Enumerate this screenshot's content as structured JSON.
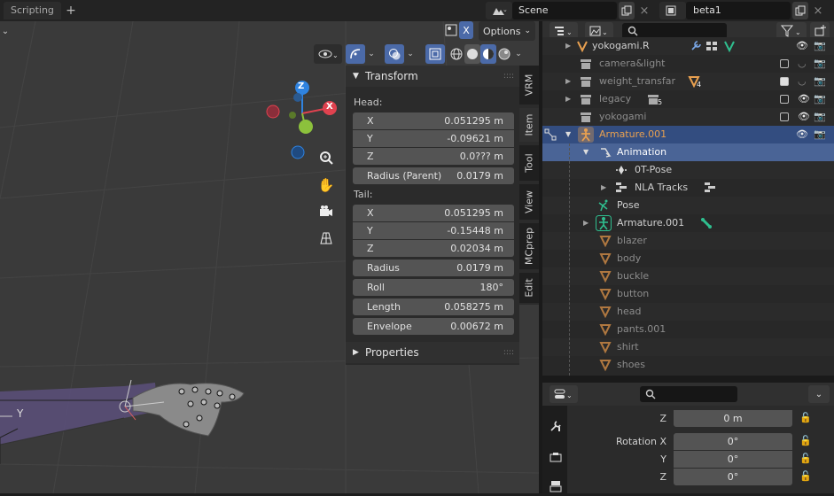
{
  "topbar": {
    "workspace_tab": "Scripting",
    "add_tab": "+",
    "scene_name": "Scene",
    "view_layer_name": "beta1"
  },
  "viewport": {
    "options_label": "Options",
    "x_mirror_label": "X",
    "gizmo": {
      "z": "Z",
      "x": "X",
      "y": "Y"
    },
    "bone_axis_label": "Y"
  },
  "sidebar_tabs": [
    "VRM",
    "Item",
    "Tool",
    "View",
    "MCprep",
    "Edit"
  ],
  "npanel": {
    "transform_title": "Transform",
    "head_label": "Head:",
    "head": [
      {
        "axis": "X",
        "value": "0.051295 m"
      },
      {
        "axis": "Y",
        "value": "-0.09621 m"
      },
      {
        "axis": "Z",
        "value": "0.0??? m"
      }
    ],
    "radius_parent": {
      "label": "Radius (Parent)",
      "value": "0.0179 m"
    },
    "tail_label": "Tail:",
    "tail": [
      {
        "axis": "X",
        "value": "0.051295 m"
      },
      {
        "axis": "Y",
        "value": "-0.15448 m"
      },
      {
        "axis": "Z",
        "value": "0.02034 m"
      }
    ],
    "radius": {
      "label": "Radius",
      "value": "0.0179 m"
    },
    "roll": {
      "label": "Roll",
      "value": "180°"
    },
    "length": {
      "label": "Length",
      "value": "0.058275 m"
    },
    "envelope": {
      "label": "Envelope",
      "value": "0.00672 m"
    },
    "properties_title": "Properties"
  },
  "outliner": {
    "rows": [
      {
        "name": "yokogami.R",
        "style": "normal"
      },
      {
        "name": "camera&light",
        "style": "dim"
      },
      {
        "name": "weight_transfar",
        "style": "dim",
        "badge": "4"
      },
      {
        "name": "legacy",
        "style": "dim",
        "badge": "5"
      },
      {
        "name": "yokogami",
        "style": "dim"
      },
      {
        "name": "Armature.001",
        "style": "orange"
      },
      {
        "name": "Animation",
        "style": "normal"
      },
      {
        "name": "0T-Pose",
        "style": "normal"
      },
      {
        "name": "NLA Tracks",
        "style": "normal"
      },
      {
        "name": "Pose",
        "style": "normal"
      },
      {
        "name": "Armature.001",
        "style": "normal"
      },
      {
        "name": "blazer",
        "style": "dim"
      },
      {
        "name": "body",
        "style": "dim"
      },
      {
        "name": "buckle",
        "style": "dim"
      },
      {
        "name": "button",
        "style": "dim"
      },
      {
        "name": "head",
        "style": "dim"
      },
      {
        "name": "pants.001",
        "style": "dim"
      },
      {
        "name": "shirt",
        "style": "dim"
      },
      {
        "name": "shoes",
        "style": "dim"
      }
    ]
  },
  "properties": {
    "z_label": "Z",
    "z_value": "0 m",
    "rotation_x_label": "Rotation X",
    "rotation_x_value": "0°",
    "rotation_y_label": "Y",
    "rotation_y_value": "0°",
    "rotation_z_label": "Z",
    "rotation_z_value": "0°"
  },
  "colors": {
    "selection_dark": "#334d80",
    "selection_light": "#4a6496",
    "x_axis": "#e0424f",
    "y_axis": "#8cc13c",
    "z_axis": "#2f83e0",
    "armature_orange": "#e8a050",
    "bone_green": "#2fbf8f"
  }
}
